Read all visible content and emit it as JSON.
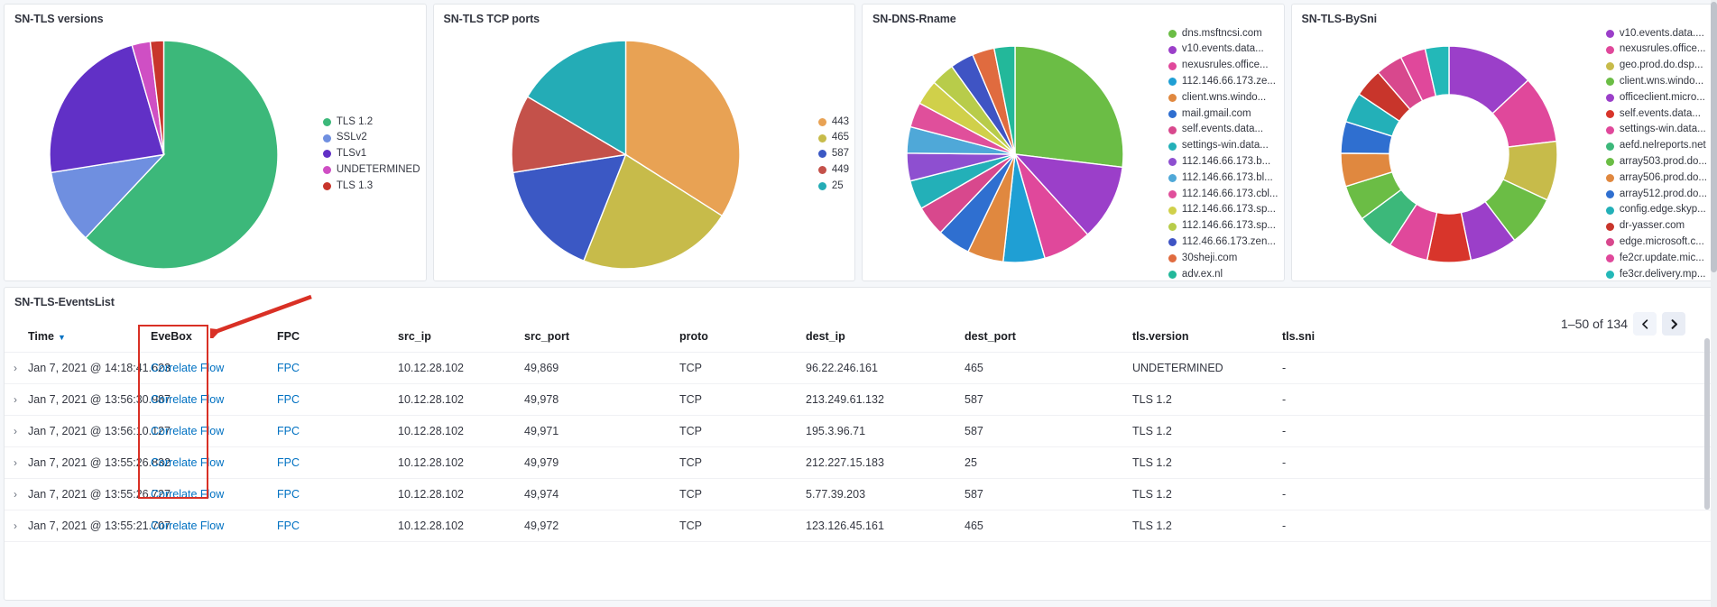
{
  "panels": [
    {
      "title": "SN-TLS versions",
      "chart_data": {
        "type": "pie",
        "title": "SN-TLS versions",
        "donut": false,
        "categories": [
          "TLS 1.2",
          "SSLv2",
          "TLSv1",
          "UNDETERMINED",
          "TLS 1.3"
        ],
        "values": [
          62.0,
          10.5,
          23.0,
          2.6,
          1.9
        ],
        "colors": [
          "#3cb87a",
          "#6f8fe0",
          "#6130c6",
          "#cf4fc4",
          "#c8352b"
        ],
        "legend_position": "right"
      },
      "legend": [
        {
          "label": "TLS 1.2",
          "color": "#3cb87a"
        },
        {
          "label": "SSLv2",
          "color": "#6f8fe0"
        },
        {
          "label": "TLSv1",
          "color": "#6130c6"
        },
        {
          "label": "UNDETERMINED",
          "color": "#cf4fc4"
        },
        {
          "label": "TLS 1.3",
          "color": "#c8352b"
        }
      ]
    },
    {
      "title": "SN-TLS TCP ports",
      "chart_data": {
        "type": "pie",
        "title": "SN-TLS TCP ports",
        "donut": false,
        "categories": [
          "443",
          "465",
          "587",
          "449",
          "25"
        ],
        "values": [
          34.0,
          22.0,
          16.5,
          11.0,
          16.5
        ],
        "colors": [
          "#e8a254",
          "#c7bb4a",
          "#3b58c4",
          "#c4514a",
          "#24acb6"
        ],
        "legend_position": "right"
      },
      "legend": [
        {
          "label": "443",
          "color": "#e8a254"
        },
        {
          "label": "465",
          "color": "#c7bb4a"
        },
        {
          "label": "587",
          "color": "#3b58c4"
        },
        {
          "label": "449",
          "color": "#c4514a"
        },
        {
          "label": "25",
          "color": "#24acb6"
        }
      ]
    },
    {
      "title": "SN-DNS-Rname",
      "chart_data": {
        "type": "pie",
        "title": "SN-DNS-Rname",
        "donut": false,
        "categories": [
          "dns.msftncsi.com",
          "v10.events.data....",
          "nexusrules.office...",
          "112.146.66.173.ze...",
          "client.wns.windo...",
          "mail.gmail.com",
          "self.events.data....",
          "settings-win.data...",
          "112.146.66.173.b...",
          "112.146.66.173.bl...",
          "112.146.66.173.cbl...",
          "112.146.66.173.sp...",
          "112.146.66.173.sp...",
          "112.46.66.173.zen...",
          "30sheji.com",
          "adv.ex.nl"
        ],
        "values": [
          13,
          5.5,
          3.5,
          3,
          2.6,
          2.4,
          2.2,
          2.1,
          2.0,
          1.9,
          1.8,
          1.8,
          1.7,
          1.7,
          1.6,
          1.5
        ],
        "colors": [
          "#6bbd45",
          "#9b3fc9",
          "#e0489b",
          "#1f9fd4",
          "#e0883f",
          "#2f6fd0",
          "#d8488d",
          "#23b0b8",
          "#8e4fd0",
          "#4fa8d8",
          "#e04f9b",
          "#d0d04a",
          "#b8cc4a",
          "#3f54c4",
          "#e06b3f",
          "#23b89a"
        ],
        "legend_position": "right"
      },
      "legend": [
        {
          "label": "dns.msftncsi.com",
          "color": "#6bbd45"
        },
        {
          "label": "v10.events.data...",
          "color": "#9b3fc9"
        },
        {
          "label": "nexusrules.office...",
          "color": "#e0489b"
        },
        {
          "label": "112.146.66.173.ze...",
          "color": "#1f9fd4"
        },
        {
          "label": "client.wns.windo...",
          "color": "#e0883f"
        },
        {
          "label": "mail.gmail.com",
          "color": "#2f6fd0"
        },
        {
          "label": "self.events.data...",
          "color": "#d8488d"
        },
        {
          "label": "settings-win.data...",
          "color": "#23b0b8"
        },
        {
          "label": "112.146.66.173.b...",
          "color": "#8e4fd0"
        },
        {
          "label": "112.146.66.173.bl...",
          "color": "#4fa8d8"
        },
        {
          "label": "112.146.66.173.cbl...",
          "color": "#e04f9b"
        },
        {
          "label": "112.146.66.173.sp...",
          "color": "#d0d04a"
        },
        {
          "label": "112.146.66.173.sp...",
          "color": "#b8cc4a"
        },
        {
          "label": "112.46.66.173.zen...",
          "color": "#3f54c4"
        },
        {
          "label": "30sheji.com",
          "color": "#e06b3f"
        },
        {
          "label": "adv.ex.nl",
          "color": "#23b89a"
        }
      ]
    },
    {
      "title": "SN-TLS-BySni",
      "chart_data": {
        "type": "pie",
        "title": "SN-TLS-BySni",
        "donut": true,
        "categories": [
          "v10.events.data....",
          "nexusrules.office...",
          "geo.prod.do.dsp...",
          "client.wns.windo...",
          "officeclient.micro...",
          "self.events.data...",
          "settings-win.data...",
          "aefd.nelreports.net",
          "array503.prod.do...",
          "array506.prod.do...",
          "array512.prod.do...",
          "config.edge.skyp...",
          "dr-yasser.com",
          "edge.microsoft.c...",
          "fe2cr.update.mic...",
          "fe3cr.delivery.mp..."
        ],
        "values": [
          11,
          8.5,
          7.5,
          6.5,
          6.0,
          5.5,
          5.0,
          4.8,
          4.5,
          4.2,
          4.0,
          3.8,
          3.6,
          3.4,
          3.2,
          3.0
        ],
        "colors": [
          "#9b3fc9",
          "#e0489b",
          "#c7bb4a",
          "#6bbd45",
          "#9b3fc9",
          "#d8352b",
          "#e0489b",
          "#3cb87a",
          "#6bbd45",
          "#e0883f",
          "#2f6fd0",
          "#23b0b8",
          "#c8352b",
          "#d8488d",
          "#e0489b",
          "#23b8b8"
        ],
        "legend_position": "right"
      },
      "legend": [
        {
          "label": "v10.events.data....",
          "color": "#9b3fc9"
        },
        {
          "label": "nexusrules.office...",
          "color": "#e0489b"
        },
        {
          "label": "geo.prod.do.dsp...",
          "color": "#c7bb4a"
        },
        {
          "label": "client.wns.windo...",
          "color": "#6bbd45"
        },
        {
          "label": "officeclient.micro...",
          "color": "#9b3fc9"
        },
        {
          "label": "self.events.data...",
          "color": "#d8352b"
        },
        {
          "label": "settings-win.data...",
          "color": "#e0489b"
        },
        {
          "label": "aefd.nelreports.net",
          "color": "#3cb87a"
        },
        {
          "label": "array503.prod.do...",
          "color": "#6bbd45"
        },
        {
          "label": "array506.prod.do...",
          "color": "#e0883f"
        },
        {
          "label": "array512.prod.do...",
          "color": "#2f6fd0"
        },
        {
          "label": "config.edge.skyp...",
          "color": "#23b0b8"
        },
        {
          "label": "dr-yasser.com",
          "color": "#c8352b"
        },
        {
          "label": "edge.microsoft.c...",
          "color": "#d8488d"
        },
        {
          "label": "fe2cr.update.mic...",
          "color": "#e0489b"
        },
        {
          "label": "fe3cr.delivery.mp...",
          "color": "#23b8b8"
        }
      ]
    }
  ],
  "events": {
    "title": "SN-TLS-EventsList",
    "pager": {
      "range_text": "1–50 of 134",
      "prev_icon": "chevron-left-icon",
      "next_icon": "chevron-right-icon"
    },
    "columns": [
      "Time",
      "EveBox",
      "FPC",
      "src_ip",
      "src_port",
      "proto",
      "dest_ip",
      "dest_port",
      "tls.version",
      "tls.sni"
    ],
    "sort_column": "Time",
    "sort_direction": "desc",
    "rows": [
      {
        "time": "Jan 7, 2021 @ 14:18:41.623",
        "evebox": "Correlate Flow",
        "fpc": "FPC",
        "src_ip": "10.12.28.102",
        "src_port": "49,869",
        "proto": "TCP",
        "dest_ip": "96.22.246.161",
        "dest_port": "465",
        "tls_version": "UNDETERMINED",
        "tls_sni": "-"
      },
      {
        "time": "Jan 7, 2021 @ 13:56:30.987",
        "evebox": "Correlate Flow",
        "fpc": "FPC",
        "src_ip": "10.12.28.102",
        "src_port": "49,978",
        "proto": "TCP",
        "dest_ip": "213.249.61.132",
        "dest_port": "587",
        "tls_version": "TLS 1.2",
        "tls_sni": "-"
      },
      {
        "time": "Jan 7, 2021 @ 13:56:10.127",
        "evebox": "Correlate Flow",
        "fpc": "FPC",
        "src_ip": "10.12.28.102",
        "src_port": "49,971",
        "proto": "TCP",
        "dest_ip": "195.3.96.71",
        "dest_port": "587",
        "tls_version": "TLS 1.2",
        "tls_sni": "-"
      },
      {
        "time": "Jan 7, 2021 @ 13:55:26.832",
        "evebox": "Correlate Flow",
        "fpc": "FPC",
        "src_ip": "10.12.28.102",
        "src_port": "49,979",
        "proto": "TCP",
        "dest_ip": "212.227.15.183",
        "dest_port": "25",
        "tls_version": "TLS 1.2",
        "tls_sni": "-"
      },
      {
        "time": "Jan 7, 2021 @ 13:55:26.727",
        "evebox": "Correlate Flow",
        "fpc": "FPC",
        "src_ip": "10.12.28.102",
        "src_port": "49,974",
        "proto": "TCP",
        "dest_ip": "5.77.39.203",
        "dest_port": "587",
        "tls_version": "TLS 1.2",
        "tls_sni": "-"
      },
      {
        "time": "Jan 7, 2021 @ 13:55:21.707",
        "evebox": "Correlate Flow",
        "fpc": "FPC",
        "src_ip": "10.12.28.102",
        "src_port": "49,972",
        "proto": "TCP",
        "dest_ip": "123.126.45.161",
        "dest_port": "465",
        "tls_version": "TLS 1.2",
        "tls_sni": "-"
      }
    ]
  },
  "annotation": {
    "highlight_color": "#d93025",
    "target_column": "EveBox"
  }
}
